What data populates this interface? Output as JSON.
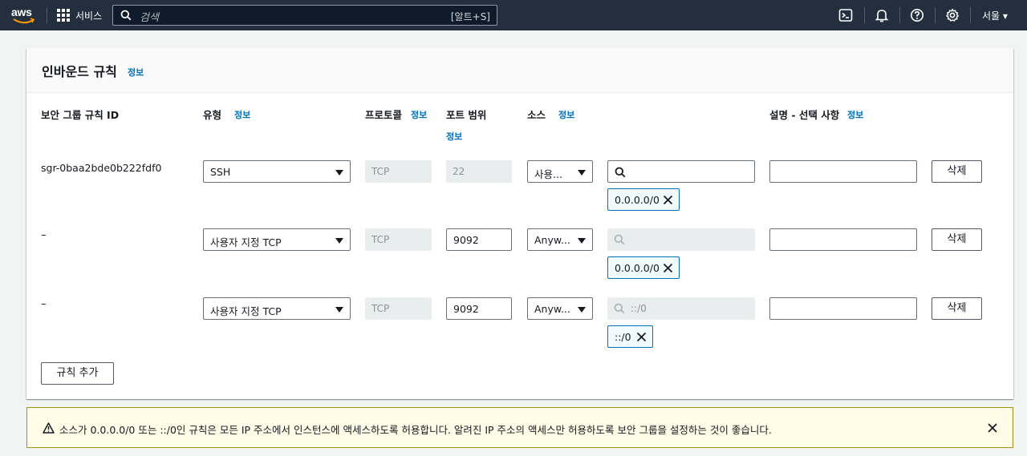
{
  "topnav": {
    "logo": "aws",
    "services_label": "서비스",
    "search_placeholder": "검색",
    "search_shortcut": "[알트+S]",
    "region": "서울 ▾",
    "icons": [
      "cloudshell-icon",
      "bell-icon",
      "help-icon",
      "settings-icon"
    ]
  },
  "panel": {
    "title": "인바운드 규칙",
    "info": "정보"
  },
  "columns": {
    "rule_id": "보안 그룹 규칙 ID",
    "type": "유형",
    "type_info": "정보",
    "protocol": "프로토콜",
    "protocol_info": "정보",
    "port_range": "포트 범위",
    "port_range_info": "정보",
    "source": "소스",
    "source_info": "정보",
    "description": "설명 - 선택 사항",
    "description_info": "정보"
  },
  "rows": [
    {
      "rule_id": "sgr-0baa2bde0b222fdf0",
      "type": "SSH",
      "protocol": "TCP",
      "port": "22",
      "source_type": "사용...",
      "cidr_placeholder": "",
      "token": "0.0.0.0/0",
      "description": "",
      "delete_label": "삭제"
    },
    {
      "rule_id": "–",
      "type": "사용자 지정 TCP",
      "protocol": "TCP",
      "port": "9092",
      "source_type": "Anyw...",
      "cidr_placeholder": "",
      "token": "0.0.0.0/0",
      "description": "",
      "delete_label": "삭제"
    },
    {
      "rule_id": "–",
      "type": "사용자 지정 TCP",
      "protocol": "TCP",
      "port": "9092",
      "source_type": "Anyw...",
      "cidr_placeholder": "::/0",
      "token": "::/0",
      "description": "",
      "delete_label": "삭제"
    }
  ],
  "add_rule_label": "규칙 추가",
  "alert": {
    "message": "소스가 0.0.0.0/0 또는 ::/0인 규칙은 모든 IP 주소에서 인스턴스에 액세스하도록 허용합니다. 알려진 IP 주소의 액세스만 허용하도록 보안 그룹을 설정하는 것이 좋습니다."
  }
}
